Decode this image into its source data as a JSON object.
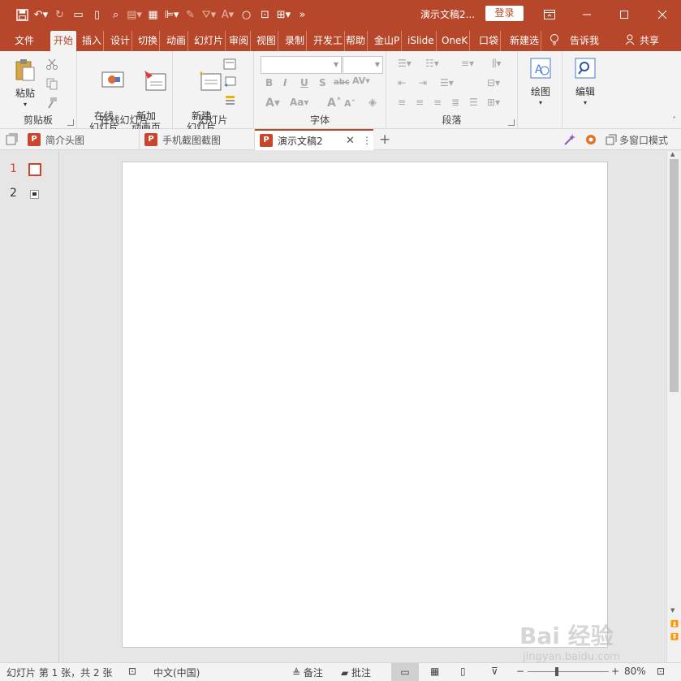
{
  "window": {
    "doc_title": "演示文稿2...",
    "login_label": "登录"
  },
  "ribbon_tabs": [
    "文件",
    "开始",
    "插入",
    "设计",
    "切换",
    "动画",
    "幻灯片",
    "审阅",
    "视图",
    "录制",
    "开发工",
    "帮助",
    "金山P",
    "iSlide",
    "OneK",
    "口袋",
    "新建选"
  ],
  "active_tab": "开始",
  "tell_me": "告诉我",
  "share": "共享",
  "ribbon": {
    "clipboard": {
      "paste_label": "粘贴",
      "group_label": "剪贴板"
    },
    "online": {
      "online_slides_label": "在线\n幻灯片",
      "add_anim_label": "新加\n动画页",
      "group_label": "在线幻灯片"
    },
    "slides": {
      "new_slide_label": "新建\n幻灯片",
      "group_label": "幻灯片"
    },
    "font": {
      "group_label": "字体"
    },
    "paragraph": {
      "group_label": "段落"
    },
    "drawing": {
      "label": "绘图"
    },
    "editing": {
      "label": "编辑"
    }
  },
  "doc_tabs": [
    {
      "label": "简介头图"
    },
    {
      "label": "手机截图截图"
    },
    {
      "label": "演示文稿2",
      "active": true
    }
  ],
  "multi_window": "多窗口模式",
  "thumbnails": [
    {
      "number": "1"
    },
    {
      "number": "2"
    }
  ],
  "status": {
    "slide_info": "幻灯片 第 1 张，共 2 张",
    "language": "中文(中国)",
    "notes": "备注",
    "comments": "批注",
    "zoom": "80%"
  },
  "watermark": {
    "brand": "Bai 经验",
    "url": "jingyan.baidu.com"
  },
  "colors": {
    "accent": "#b7472a",
    "ribbon_bg": "#f3f3f3",
    "workspace_bg": "#e6e6e6"
  }
}
